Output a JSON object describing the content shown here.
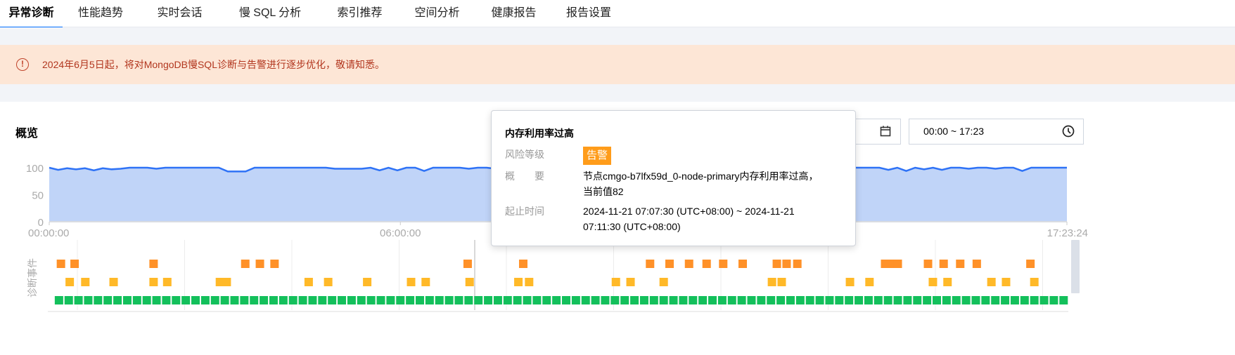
{
  "tabs": [
    {
      "label": "异常诊断",
      "active": true
    },
    {
      "label": "性能趋势"
    },
    {
      "label": "实时会话"
    },
    {
      "label": "慢 SQL 分析"
    },
    {
      "label": "索引推荐"
    },
    {
      "label": "空间分析"
    },
    {
      "label": "健康报告"
    },
    {
      "label": "报告设置"
    }
  ],
  "banner": {
    "icon": "exclamation-circle-icon",
    "text": "2024年6月5日起，将对MongoDB慢SQL诊断与告警进行逐步优化，敬请知悉。"
  },
  "overview": {
    "title": "概览",
    "date_picker": {
      "icon": "calendar-icon"
    },
    "time_range": {
      "value": "00:00 ~ 17:23",
      "icon": "clock-icon"
    }
  },
  "tooltip": {
    "title": "内存利用率过高",
    "risk_label": "风险等级",
    "risk_value": "告警",
    "risk_color": "#ff9c1a",
    "summary_label": "概　　要",
    "summary_value": "节点cmgo-b7lfx59d_0-node-primary内存利用率过高，当前值82",
    "time_label": "起止时间",
    "time_value": "2024-11-21 07:07:30 (UTC+08:00) ~ 2024-11-21 07:11:30 (UTC+08:00)"
  },
  "chart_data": {
    "type": "area",
    "y_ticks": [
      "100",
      "50",
      "0"
    ],
    "ylim": [
      0,
      100
    ],
    "x_ticks": [
      "00:00:00",
      "06:00:00",
      "17:23:24"
    ],
    "color": "#2e72f6",
    "fill": "#c0d4f8",
    "values": [
      100,
      96,
      99,
      97,
      99,
      95,
      99,
      97,
      98,
      100,
      100,
      100,
      98,
      100,
      100,
      100,
      100,
      100,
      100,
      100,
      93,
      93,
      93,
      100,
      100,
      100,
      100,
      100,
      100,
      100,
      100,
      100,
      98,
      98,
      98,
      98,
      100,
      95,
      100,
      95,
      100,
      100,
      94,
      100,
      100,
      100,
      100,
      98,
      100,
      100,
      98,
      98,
      100,
      100,
      100,
      100,
      97,
      100,
      100,
      100,
      100,
      100,
      100,
      100,
      96,
      100,
      100,
      100,
      100,
      100,
      100,
      100,
      100,
      100,
      100,
      97,
      100,
      100,
      100,
      100,
      100,
      98,
      100,
      100,
      98,
      98,
      100,
      100,
      100,
      96,
      100,
      100,
      100,
      100,
      96,
      100,
      94,
      100,
      97,
      100,
      96,
      100,
      100,
      98,
      100,
      100,
      98,
      100,
      100,
      94,
      100,
      100,
      100,
      100,
      100
    ],
    "event_axis_label": "诊断事件",
    "events": {
      "severe": {
        "color": "#ff9128",
        "times": [
          "00:12",
          "00:26",
          "01:47",
          "03:21",
          "03:36",
          "03:51",
          "07:09",
          "08:06",
          "10:16",
          "10:36",
          "10:56",
          "11:14",
          "11:31",
          "11:51",
          "12:26",
          "12:36",
          "12:47",
          "14:17",
          "14:24",
          "14:30",
          "15:01",
          "15:17",
          "15:34",
          "15:51",
          "16:46"
        ]
      },
      "warning": {
        "color": "#ffb928",
        "times": [
          "00:21",
          "00:37",
          "01:06",
          "01:47",
          "02:01",
          "02:55",
          "03:02",
          "04:26",
          "04:46",
          "05:26",
          "06:11",
          "06:26",
          "07:11",
          "08:01",
          "08:12",
          "09:41",
          "09:56",
          "10:30",
          "12:21",
          "12:31",
          "13:41",
          "14:01",
          "15:06",
          "15:21",
          "16:06",
          "16:21",
          "16:50"
        ]
      },
      "healthy": {
        "color": "#13c05b",
        "interval_minutes": 10
      }
    }
  }
}
